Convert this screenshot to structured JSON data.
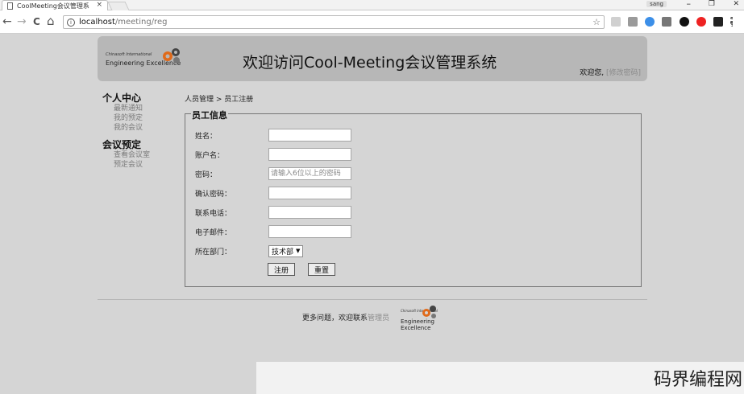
{
  "browser": {
    "tab_title": "CoolMeeting会议管理系",
    "tab_close": "×",
    "user_chip": "sang",
    "minimize": "–",
    "restore": "❐",
    "close": "✕",
    "url_host": "localhost",
    "url_path": "/meeting/reg",
    "back": "←",
    "forward": "→",
    "reload": "C",
    "home": "⌂",
    "star": "☆"
  },
  "header": {
    "logo_small": "Chinasoft International",
    "logo_big": "Engineering Excellence",
    "title": "欢迎访问Cool-Meeting会议管理系统",
    "welcome": "欢迎您,",
    "change_password": "[修改密码]"
  },
  "sidebar": {
    "group1": "个人中心",
    "group1_items": [
      "最新通知",
      "我的预定",
      "我的会议"
    ],
    "group2": "会议预定",
    "group2_items": [
      "查看会议室",
      "预定会议"
    ]
  },
  "breadcrumb": "人员管理 > 员工注册",
  "form": {
    "legend": "员工信息",
    "name_label": "姓名：",
    "account_label": "账户名：",
    "password_label": "密码：",
    "password_placeholder": "请输入6位以上的密码",
    "confirm_label": "确认密码：",
    "phone_label": "联系电话：",
    "email_label": "电子邮件：",
    "dept_label": "所在部门：",
    "dept_value": "技术部",
    "register_button": "注册",
    "reset_button": "重置"
  },
  "footer": {
    "text": "更多问题，欢迎联系",
    "admin_link": "管理员",
    "logo_small": "Chinasoft International",
    "logo_big": "Engineering Excellence"
  },
  "watermark": "码界编程网"
}
